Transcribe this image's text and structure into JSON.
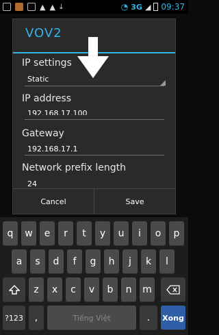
{
  "status_bar": {
    "network": "3G",
    "time": "09:37"
  },
  "dialog": {
    "title": "VOV2",
    "ip_settings_label": "IP settings",
    "ip_settings_value": "Static",
    "ip_address_label": "IP address",
    "ip_address_value": "192.168.17.100",
    "gateway_label": "Gateway",
    "gateway_value": "192.168.17.1",
    "prefix_label": "Network prefix length",
    "prefix_value": "24",
    "cancel_label": "Cancel",
    "save_label": "Save"
  },
  "keyboard": {
    "row1": [
      "q",
      "w",
      "e",
      "r",
      "t",
      "y",
      "u",
      "i",
      "o",
      "p"
    ],
    "row2": [
      "a",
      "s",
      "d",
      "f",
      "g",
      "h",
      "j",
      "k",
      "l"
    ],
    "row3": [
      "z",
      "x",
      "c",
      "v",
      "b",
      "n",
      "m"
    ],
    "symbols_label": "?123",
    "comma_label": ",",
    "space_label": "Tiếng Việt",
    "period_label": ".",
    "action_label": "Xong"
  },
  "colors": {
    "accent": "#33b5e5",
    "action_key": "#2f5fa6"
  },
  "icons": [
    "shift-icon",
    "backspace-icon",
    "arrow-down-icon",
    "wifi-icon",
    "signal-icon",
    "battery-icon"
  ]
}
